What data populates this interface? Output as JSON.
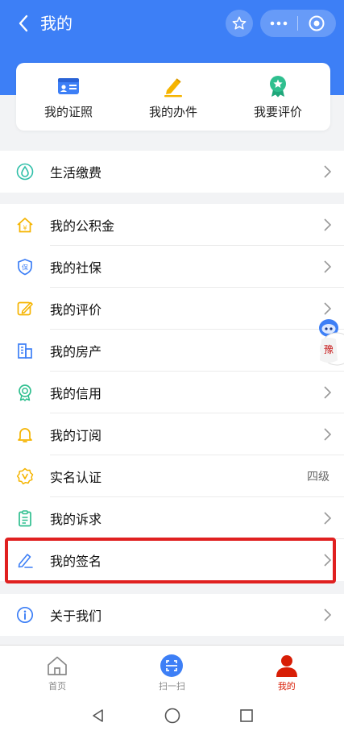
{
  "header": {
    "title": "我的",
    "icons": [
      "back-chevron-icon",
      "star-icon",
      "more-dots-icon",
      "close-circle-icon"
    ]
  },
  "quick_actions": [
    {
      "label": "我的证照",
      "icon": "id-card-icon",
      "color": "#3d7ff6"
    },
    {
      "label": "我的办件",
      "icon": "pencil-icon",
      "color": "#f5b400"
    },
    {
      "label": "我要评价",
      "icon": "badge-star-icon",
      "color": "#2fbf8f"
    }
  ],
  "sections": [
    {
      "items": [
        {
          "label": "生活缴费",
          "icon": "water-drop-icon"
        }
      ]
    },
    {
      "items": [
        {
          "label": "我的公积金",
          "icon": "house-fund-icon"
        },
        {
          "label": "我的社保",
          "icon": "shield-icon"
        },
        {
          "label": "我的评价",
          "icon": "edit-square-icon"
        },
        {
          "label": "我的房产",
          "icon": "building-icon"
        },
        {
          "label": "我的信用",
          "icon": "credit-badge-icon"
        },
        {
          "label": "我的订阅",
          "icon": "bell-icon"
        },
        {
          "label": "实名认证",
          "icon": "verified-icon",
          "value": "四级"
        },
        {
          "label": "我的诉求",
          "icon": "clipboard-icon"
        },
        {
          "label": "我的签名",
          "icon": "signature-pen-icon"
        }
      ]
    },
    {
      "items": [
        {
          "label": "关于我们",
          "icon": "info-icon"
        }
      ]
    }
  ],
  "assistant": {
    "icon": "robot-assistant-icon",
    "badge": "豫"
  },
  "tabbar": [
    {
      "label": "首页",
      "icon": "home-icon"
    },
    {
      "label": "扫一扫",
      "icon": "scan-icon"
    },
    {
      "label": "我的",
      "icon": "user-icon",
      "active": true
    }
  ],
  "system_nav": [
    "back-triangle-icon",
    "home-circle-icon",
    "recent-square-icon"
  ],
  "colors": {
    "primary": "#3d7ff6",
    "active_tab": "#d81e06",
    "highlight": "#e02020"
  }
}
